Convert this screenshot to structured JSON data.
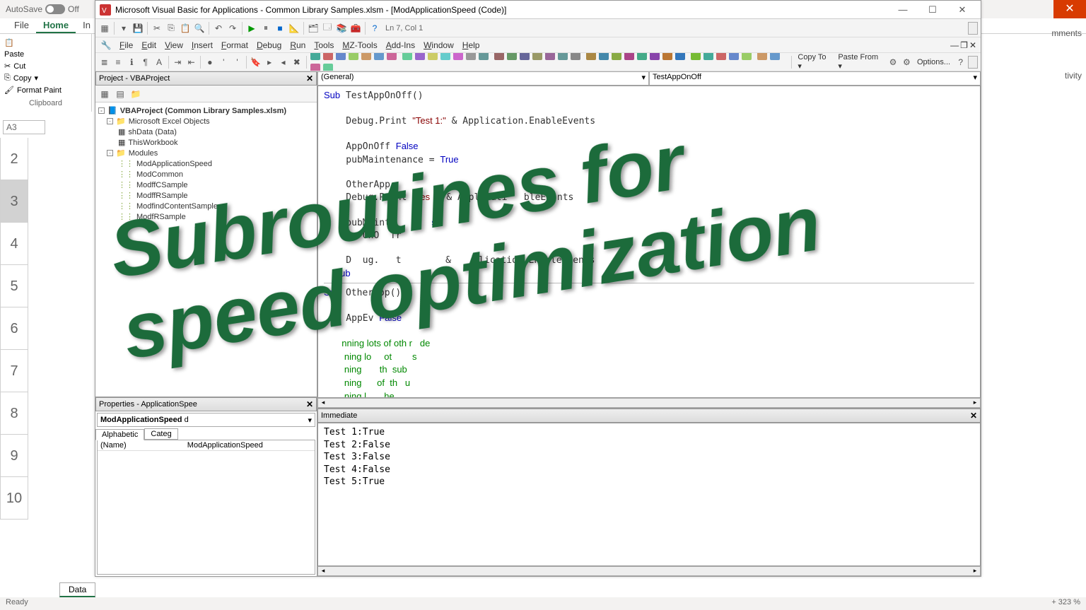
{
  "excel": {
    "autosave_label": "AutoSave",
    "autosave_state": "Off",
    "ribbon_tabs": [
      "File",
      "Home",
      "In"
    ],
    "clipboard": {
      "paste": "Paste",
      "cut": "Cut",
      "copy": "Copy",
      "format": "Format Paint",
      "group": "Clipboard"
    },
    "name_box": "A3",
    "rows": [
      "2",
      "3",
      "4",
      "5",
      "6",
      "7",
      "8",
      "9",
      "10"
    ],
    "sheet_tab": "Data",
    "status_left": "Ready",
    "status_right": "323 %",
    "right_label_1": "mments",
    "right_label_2": "tivity"
  },
  "vba": {
    "title": "Microsoft Visual Basic for Applications - Common Library Samples.xlsm - [ModApplicationSpeed (Code)]",
    "toolbar_status": "Ln 7, Col 1",
    "menus": [
      "File",
      "Edit",
      "View",
      "Insert",
      "Format",
      "Debug",
      "Run",
      "Tools",
      "MZ-Tools",
      "Add-Ins",
      "Window",
      "Help"
    ],
    "toolbar2_text": [
      "Copy To",
      "Paste From",
      "Options..."
    ],
    "project": {
      "title": "Project - VBAProject",
      "root": "VBAProject (Common Library Samples.xlsm)",
      "excel_objects": "Microsoft Excel Objects",
      "sheets": [
        "shData (Data)",
        "ThisWorkbook"
      ],
      "modules_label": "Modules",
      "modules": [
        "ModApplicationSpeed",
        "ModCommon",
        "ModffCSample",
        "ModffRSample",
        "ModfindContentSample",
        "ModfRSample"
      ]
    },
    "properties": {
      "title_prefix": "Properties - ",
      "title_name": "ApplicationSpee",
      "combo": "ModApplicationSpeed",
      "combo_suffix": "d",
      "tabs": [
        "Alphabetic",
        "Categ"
      ],
      "name_key": "(Name)",
      "name_val": "ModApplicationSpeed"
    },
    "code": {
      "left_combo": "(General)",
      "right_combo": "TestAppOnOff",
      "lines": [
        {
          "t": "kw",
          "s": "Sub"
        },
        {
          "t": "",
          "s": " TestAppOnOff()"
        },
        {
          "t": "nl"
        },
        {
          "t": "nl"
        },
        {
          "t": "ind",
          "s": "    Debug.Print "
        },
        {
          "t": "str",
          "s": "\"Test 1:\""
        },
        {
          "t": "",
          "s": " & Application.EnableEvents"
        },
        {
          "t": "nl"
        },
        {
          "t": "nl"
        },
        {
          "t": "ind",
          "s": "    AppOnOff "
        },
        {
          "t": "kw",
          "s": "False"
        },
        {
          "t": "nl"
        },
        {
          "t": "ind",
          "s": "    pubMaintenance = "
        },
        {
          "t": "kw",
          "s": "True"
        },
        {
          "t": "nl"
        },
        {
          "t": "nl"
        },
        {
          "t": "ind",
          "s": "    OtherApp"
        },
        {
          "t": "nl"
        },
        {
          "t": "ind",
          "s": "    Debug.Print "
        },
        {
          "t": "str",
          "s": "\"Tes   \""
        },
        {
          "t": "",
          "s": " & Applicati   bleE  nts"
        },
        {
          "t": "nl"
        },
        {
          "t": "nl"
        },
        {
          "t": "ind",
          "s": "    pubMaint       "
        },
        {
          "t": "kw",
          "s": " se"
        },
        {
          "t": "nl"
        },
        {
          "t": "ind",
          "s": "    A  OnO  Tr"
        },
        {
          "t": "nl"
        },
        {
          "t": "nl"
        },
        {
          "t": "ind",
          "s": "    D  ug.   t        &    plication.EnableEvents"
        },
        {
          "t": "nl"
        },
        {
          "t": "kw",
          "s": "    Sub"
        },
        {
          "t": "nl"
        },
        {
          "t": "hr"
        },
        {
          "t": "kw",
          "s": "Sub"
        },
        {
          "t": "",
          "s": " OtherApp()"
        },
        {
          "t": "nl"
        },
        {
          "t": "nl"
        },
        {
          "t": "ind",
          "s": "    AppEv "
        },
        {
          "t": "kw",
          "s": "False"
        },
        {
          "t": "nl"
        },
        {
          "t": "nl"
        },
        {
          "t": "cmt",
          "s": "       nning lots of oth r   de"
        },
        {
          "t": "nl"
        },
        {
          "t": "cmt",
          "s": "        ning lo     ot        s"
        },
        {
          "t": "nl"
        },
        {
          "t": "cmt",
          "s": "        ning       th  sub"
        },
        {
          "t": "nl"
        },
        {
          "t": "cmt",
          "s": "        ning      of  th   u"
        },
        {
          "t": "nl"
        },
        {
          "t": "cmt",
          "s": "        ning l       he"
        },
        {
          "t": "nl"
        }
      ]
    },
    "immediate": {
      "title": "Immediate",
      "lines": [
        "Test 1:True",
        "Test 2:False",
        "Test 3:False",
        "Test 4:False",
        "Test 5:True"
      ]
    }
  },
  "overlay_line1": "Subroutines for",
  "overlay_line2": "speed optimization"
}
